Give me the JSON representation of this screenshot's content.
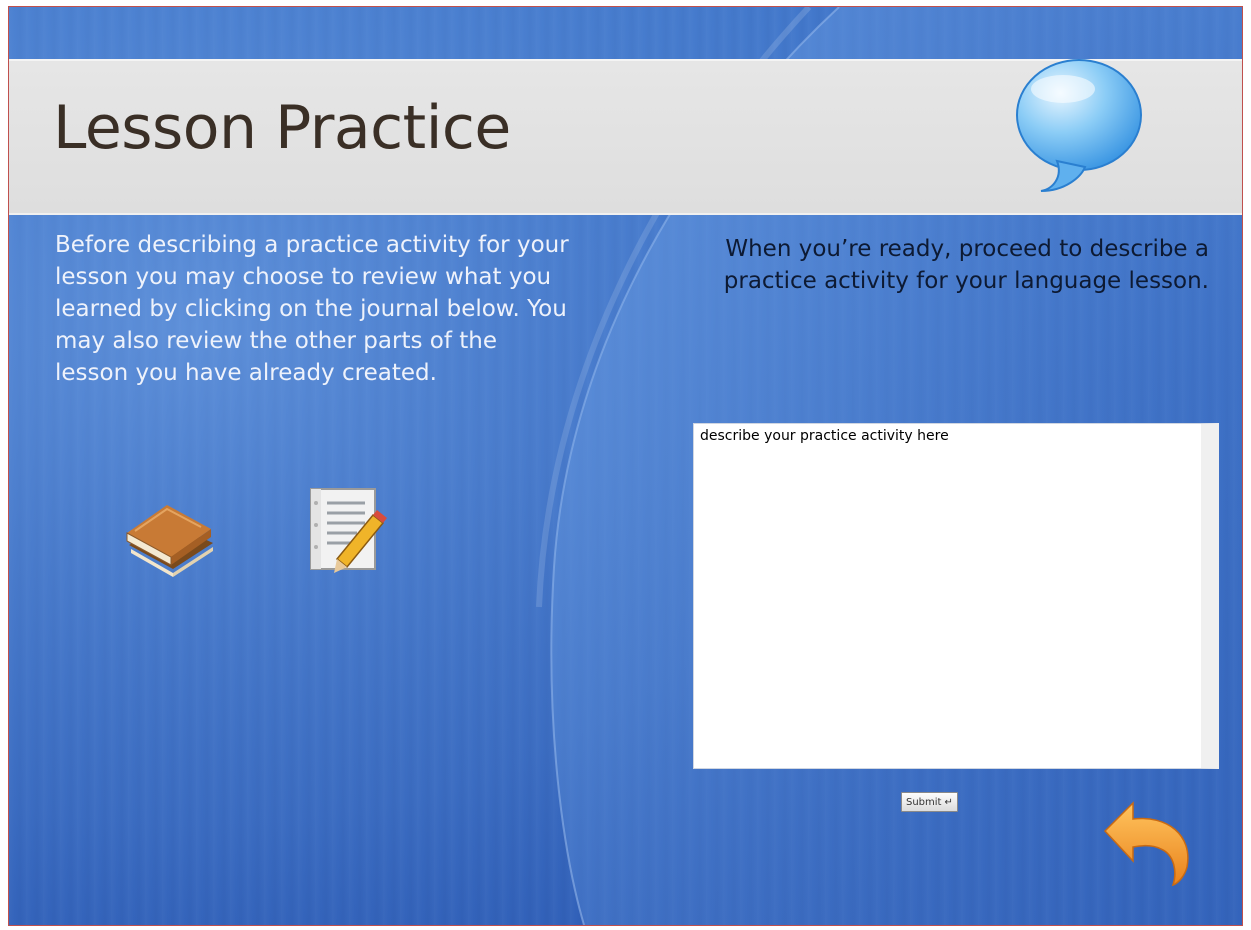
{
  "slide": {
    "title": "Lesson Practice",
    "left_instructions": "Before describing a practice activity for your lesson you may choose to review what you learned by clicking on the journal below.  You may also review the other parts of the lesson you have already created.",
    "right_instructions": "When you’re ready, proceed to describe a practice activity for your language lesson."
  },
  "icons": {
    "book": "book-icon",
    "journal": "journal-pencil-icon",
    "bubble": "speech-bubble-icon",
    "back": "back-arrow-icon"
  },
  "form": {
    "activity_value": "describe your practice activity here",
    "submit_label": "Submit",
    "submit_glyph": "↵"
  },
  "colors": {
    "background": "#3467bf",
    "title_band": "#e0e0e0",
    "title_text": "#3a2f26",
    "accent_orange": "#f0922a"
  }
}
